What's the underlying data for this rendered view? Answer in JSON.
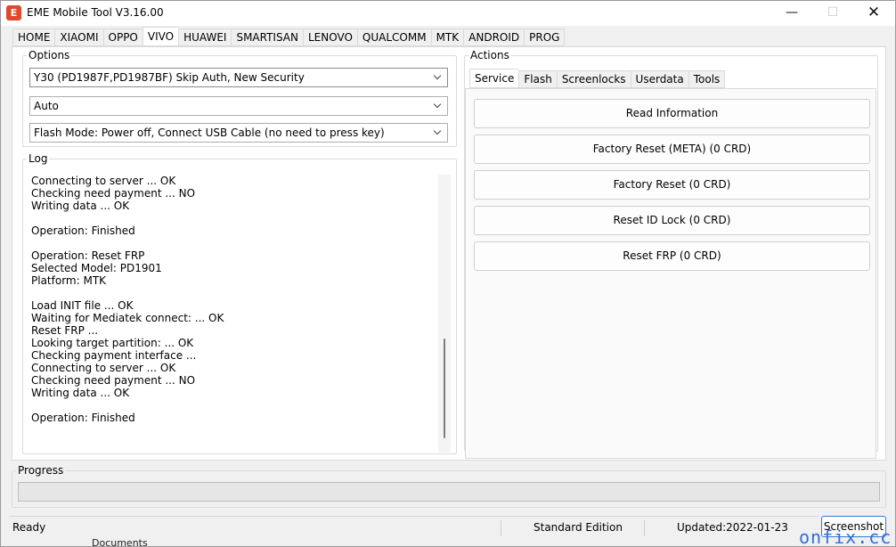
{
  "window": {
    "title": "EME Mobile Tool V3.16.00",
    "icon_letter": "E"
  },
  "main_tabs": [
    "HOME",
    "XIAOMI",
    "OPPO",
    "VIVO",
    "HUAWEI",
    "SMARTISAN",
    "LENOVO",
    "QUALCOMM",
    "MTK",
    "ANDROID",
    "PROG"
  ],
  "active_main_tab": "VIVO",
  "options": {
    "legend": "Options",
    "model": "Y30 (PD1987F,PD1987BF) Skip Auth, New Security",
    "mode": "Auto",
    "flash_mode": "Flash Mode: Power off, Connect USB Cable (no need to press key)"
  },
  "log": {
    "legend": "Log",
    "lines": [
      "Connecting to server ... OK",
      "Checking need payment ... NO",
      "Writing data ... OK",
      "",
      "Operation: Finished",
      "",
      "Operation: Reset FRP",
      "Selected Model: PD1901",
      "Platform: MTK",
      "",
      "Load INIT file ... OK",
      "Waiting for Mediatek connect: ... OK",
      "Reset FRP ...",
      "Looking target partition: ... OK",
      "Checking payment interface ...",
      "Connecting to server ... OK",
      "Checking need payment ... NO",
      "Writing data ... OK",
      "",
      "Operation: Finished"
    ]
  },
  "actions": {
    "legend": "Actions",
    "tabs": [
      "Service",
      "Flash",
      "Screenlocks",
      "Userdata",
      "Tools"
    ],
    "active_tab": "Service",
    "buttons": [
      "Read Information",
      "Factory Reset (META) (0 CRD)",
      "Factory Reset (0 CRD)",
      "Reset ID Lock (0 CRD)",
      "Reset FRP (0 CRD)"
    ]
  },
  "progress": {
    "legend": "Progress",
    "value": 0
  },
  "status": {
    "text": "Ready",
    "edition": "Standard Edition",
    "updated": "Updated:2022-01-23",
    "screenshot_label": "Screenshot"
  },
  "overlay": {
    "watermark": "onfix.cc",
    "background_text": "Documents"
  }
}
